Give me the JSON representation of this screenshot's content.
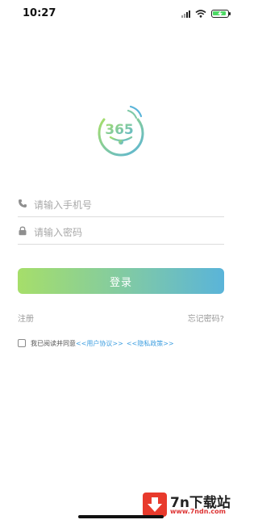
{
  "status_bar": {
    "time": "10:27",
    "battery_charging": true
  },
  "logo": {
    "text": "365",
    "colors": [
      "#9dd66f",
      "#5ab4d9"
    ]
  },
  "form": {
    "phone_placeholder": "请输入手机号",
    "phone_value": "",
    "password_placeholder": "请输入密码",
    "password_value": "",
    "login_label": "登录"
  },
  "links": {
    "register": "注册",
    "forgot_password": "忘记密码?"
  },
  "agreement": {
    "checked": false,
    "prefix": "我已阅读并同意",
    "user_agreement": "<<用户协议>>",
    "privacy_policy": "<<隐私政策>>"
  },
  "watermark": {
    "title": "7n下载站",
    "url": "www.7ndn.com"
  },
  "colors": {
    "gradient_start": "#a6de6a",
    "gradient_end": "#5ab4d9",
    "link": "#3f9fe0",
    "watermark_red": "#e83a2c"
  }
}
